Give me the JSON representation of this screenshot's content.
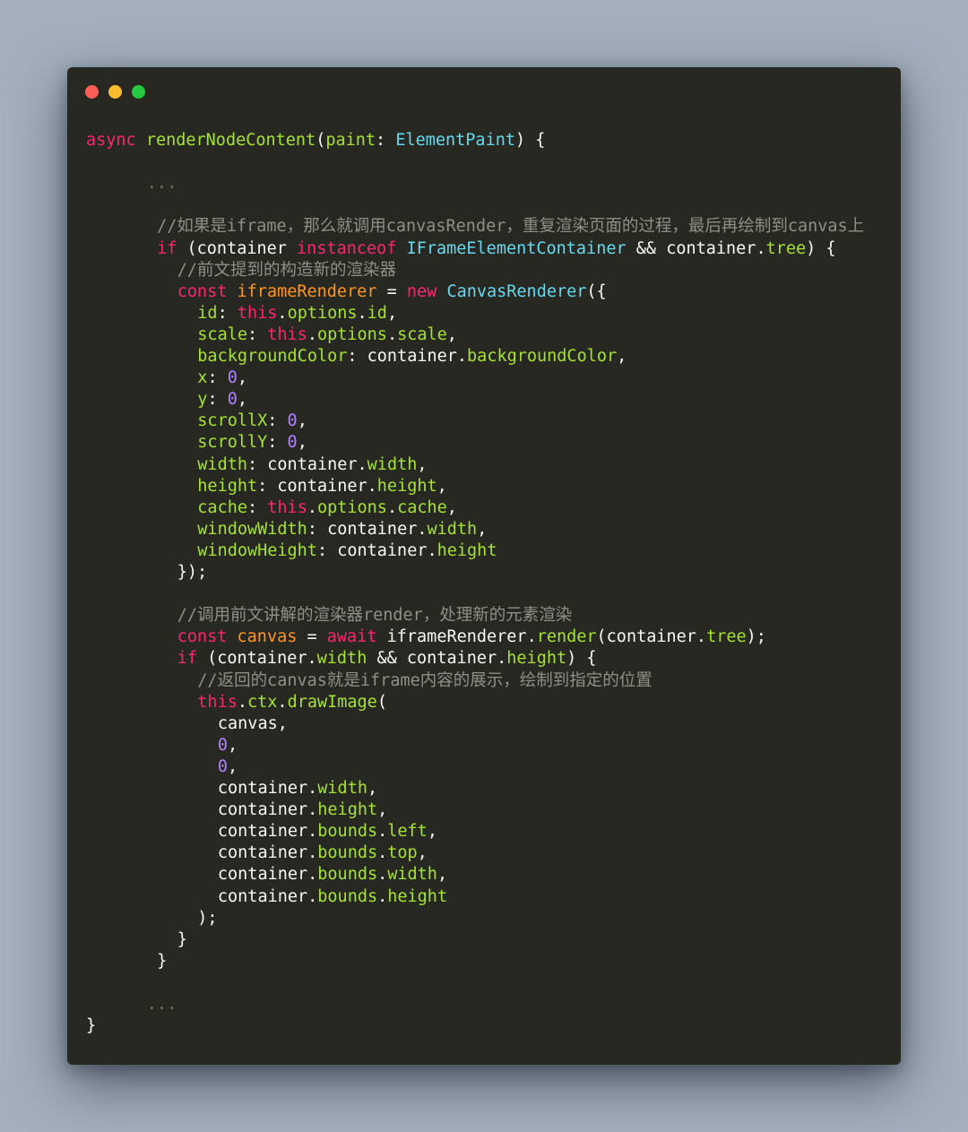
{
  "window": {
    "lights": [
      {
        "name": "close",
        "color": "#ff5f56"
      },
      {
        "name": "minimize",
        "color": "#ffbd2e"
      },
      {
        "name": "maximize",
        "color": "#27c93f"
      }
    ]
  },
  "colors": {
    "background": "#a3afbc",
    "editor": "#272822"
  },
  "code": {
    "lines": [
      {
        "indent": 0,
        "tokens": [
          [
            "kw",
            "async"
          ],
          [
            "pn",
            " "
          ],
          [
            "fn",
            "renderNodeContent"
          ],
          [
            "pn",
            "("
          ],
          [
            "pr",
            "paint"
          ],
          [
            "pn",
            ": "
          ],
          [
            "ty",
            "ElementPaint"
          ],
          [
            "pn",
            ") {"
          ]
        ]
      },
      {
        "indent": 0,
        "tokens": []
      },
      {
        "indent": 3,
        "tokens": [
          [
            "cm",
            "..."
          ]
        ]
      },
      {
        "indent": 0,
        "tokens": []
      },
      {
        "indent": 3.5,
        "tokens": [
          [
            "cmi",
            "//如果是iframe，那么就调用canvasRender，重复渲染页面的过程，最后再绘制到canvas上"
          ]
        ]
      },
      {
        "indent": 3.5,
        "tokens": [
          [
            "kw",
            "if"
          ],
          [
            "pn",
            " ("
          ],
          [
            "pn",
            "container "
          ],
          [
            "kw",
            "instanceof"
          ],
          [
            "pn",
            " "
          ],
          [
            "ty",
            "IFrameElementContainer"
          ],
          [
            "pn",
            " && "
          ],
          [
            "pn",
            "container"
          ],
          [
            "pn",
            "."
          ],
          [
            "fn",
            "tree"
          ],
          [
            "pn",
            ") {"
          ]
        ]
      },
      {
        "indent": 4.5,
        "tokens": [
          [
            "cmi",
            "//前文提到的构造新的渲染器"
          ]
        ]
      },
      {
        "indent": 4.5,
        "tokens": [
          [
            "kw",
            "const"
          ],
          [
            "pn",
            " "
          ],
          [
            "vr",
            "iframeRenderer"
          ],
          [
            "pn",
            " = "
          ],
          [
            "kw",
            "new"
          ],
          [
            "pn",
            " "
          ],
          [
            "ty",
            "CanvasRenderer"
          ],
          [
            "pn",
            "({"
          ]
        ]
      },
      {
        "indent": 5.5,
        "tokens": [
          [
            "fn",
            "id"
          ],
          [
            "pn",
            ": "
          ],
          [
            "kw",
            "this"
          ],
          [
            "pn",
            "."
          ],
          [
            "fn",
            "options"
          ],
          [
            "pn",
            "."
          ],
          [
            "fn",
            "id"
          ],
          [
            "pn",
            ","
          ]
        ]
      },
      {
        "indent": 5.5,
        "tokens": [
          [
            "fn",
            "scale"
          ],
          [
            "pn",
            ": "
          ],
          [
            "kw",
            "this"
          ],
          [
            "pn",
            "."
          ],
          [
            "fn",
            "options"
          ],
          [
            "pn",
            "."
          ],
          [
            "fn",
            "scale"
          ],
          [
            "pn",
            ","
          ]
        ]
      },
      {
        "indent": 5.5,
        "tokens": [
          [
            "fn",
            "backgroundColor"
          ],
          [
            "pn",
            ": "
          ],
          [
            "pn",
            "container"
          ],
          [
            "pn",
            "."
          ],
          [
            "fn",
            "backgroundColor"
          ],
          [
            "pn",
            ","
          ]
        ]
      },
      {
        "indent": 5.5,
        "tokens": [
          [
            "fn",
            "x"
          ],
          [
            "pn",
            ": "
          ],
          [
            "nm",
            "0"
          ],
          [
            "pn",
            ","
          ]
        ]
      },
      {
        "indent": 5.5,
        "tokens": [
          [
            "fn",
            "y"
          ],
          [
            "pn",
            ": "
          ],
          [
            "nm",
            "0"
          ],
          [
            "pn",
            ","
          ]
        ]
      },
      {
        "indent": 5.5,
        "tokens": [
          [
            "fn",
            "scrollX"
          ],
          [
            "pn",
            ": "
          ],
          [
            "nm",
            "0"
          ],
          [
            "pn",
            ","
          ]
        ]
      },
      {
        "indent": 5.5,
        "tokens": [
          [
            "fn",
            "scrollY"
          ],
          [
            "pn",
            ": "
          ],
          [
            "nm",
            "0"
          ],
          [
            "pn",
            ","
          ]
        ]
      },
      {
        "indent": 5.5,
        "tokens": [
          [
            "fn",
            "width"
          ],
          [
            "pn",
            ": "
          ],
          [
            "pn",
            "container"
          ],
          [
            "pn",
            "."
          ],
          [
            "fn",
            "width"
          ],
          [
            "pn",
            ","
          ]
        ]
      },
      {
        "indent": 5.5,
        "tokens": [
          [
            "fn",
            "height"
          ],
          [
            "pn",
            ": "
          ],
          [
            "pn",
            "container"
          ],
          [
            "pn",
            "."
          ],
          [
            "fn",
            "height"
          ],
          [
            "pn",
            ","
          ]
        ]
      },
      {
        "indent": 5.5,
        "tokens": [
          [
            "fn",
            "cache"
          ],
          [
            "pn",
            ": "
          ],
          [
            "kw",
            "this"
          ],
          [
            "pn",
            "."
          ],
          [
            "fn",
            "options"
          ],
          [
            "pn",
            "."
          ],
          [
            "fn",
            "cache"
          ],
          [
            "pn",
            ","
          ]
        ]
      },
      {
        "indent": 5.5,
        "tokens": [
          [
            "fn",
            "windowWidth"
          ],
          [
            "pn",
            ": "
          ],
          [
            "pn",
            "container"
          ],
          [
            "pn",
            "."
          ],
          [
            "fn",
            "width"
          ],
          [
            "pn",
            ","
          ]
        ]
      },
      {
        "indent": 5.5,
        "tokens": [
          [
            "fn",
            "windowHeight"
          ],
          [
            "pn",
            ": "
          ],
          [
            "pn",
            "container"
          ],
          [
            "pn",
            "."
          ],
          [
            "fn",
            "height"
          ]
        ]
      },
      {
        "indent": 4.5,
        "tokens": [
          [
            "pn",
            "});"
          ]
        ]
      },
      {
        "indent": 0,
        "tokens": []
      },
      {
        "indent": 4.5,
        "tokens": [
          [
            "cmi",
            "//调用前文讲解的渲染器render，处理新的元素渲染"
          ]
        ]
      },
      {
        "indent": 4.5,
        "tokens": [
          [
            "kw",
            "const"
          ],
          [
            "pn",
            " "
          ],
          [
            "vr",
            "canvas"
          ],
          [
            "pn",
            " = "
          ],
          [
            "kw",
            "await"
          ],
          [
            "pn",
            " "
          ],
          [
            "pn",
            "iframeRenderer"
          ],
          [
            "pn",
            "."
          ],
          [
            "fn",
            "render"
          ],
          [
            "pn",
            "("
          ],
          [
            "pn",
            "container"
          ],
          [
            "pn",
            "."
          ],
          [
            "fn",
            "tree"
          ],
          [
            "pn",
            ");"
          ]
        ]
      },
      {
        "indent": 4.5,
        "tokens": [
          [
            "kw",
            "if"
          ],
          [
            "pn",
            " ("
          ],
          [
            "pn",
            "container"
          ],
          [
            "pn",
            "."
          ],
          [
            "fn",
            "width"
          ],
          [
            "pn",
            " && "
          ],
          [
            "pn",
            "container"
          ],
          [
            "pn",
            "."
          ],
          [
            "fn",
            "height"
          ],
          [
            "pn",
            ") {"
          ]
        ]
      },
      {
        "indent": 5.5,
        "tokens": [
          [
            "cmi",
            "//返回的canvas就是iframe内容的展示，绘制到指定的位置"
          ]
        ]
      },
      {
        "indent": 5.5,
        "tokens": [
          [
            "kw",
            "this"
          ],
          [
            "pn",
            "."
          ],
          [
            "fn",
            "ctx"
          ],
          [
            "pn",
            "."
          ],
          [
            "fn",
            "drawImage"
          ],
          [
            "pn",
            "("
          ]
        ]
      },
      {
        "indent": 6.5,
        "tokens": [
          [
            "pn",
            "canvas,"
          ]
        ]
      },
      {
        "indent": 6.5,
        "tokens": [
          [
            "nm",
            "0"
          ],
          [
            "pn",
            ","
          ]
        ]
      },
      {
        "indent": 6.5,
        "tokens": [
          [
            "nm",
            "0"
          ],
          [
            "pn",
            ","
          ]
        ]
      },
      {
        "indent": 6.5,
        "tokens": [
          [
            "pn",
            "container"
          ],
          [
            "pn",
            "."
          ],
          [
            "fn",
            "width"
          ],
          [
            "pn",
            ","
          ]
        ]
      },
      {
        "indent": 6.5,
        "tokens": [
          [
            "pn",
            "container"
          ],
          [
            "pn",
            "."
          ],
          [
            "fn",
            "height"
          ],
          [
            "pn",
            ","
          ]
        ]
      },
      {
        "indent": 6.5,
        "tokens": [
          [
            "pn",
            "container"
          ],
          [
            "pn",
            "."
          ],
          [
            "fn",
            "bounds"
          ],
          [
            "pn",
            "."
          ],
          [
            "fn",
            "left"
          ],
          [
            "pn",
            ","
          ]
        ]
      },
      {
        "indent": 6.5,
        "tokens": [
          [
            "pn",
            "container"
          ],
          [
            "pn",
            "."
          ],
          [
            "fn",
            "bounds"
          ],
          [
            "pn",
            "."
          ],
          [
            "fn",
            "top"
          ],
          [
            "pn",
            ","
          ]
        ]
      },
      {
        "indent": 6.5,
        "tokens": [
          [
            "pn",
            "container"
          ],
          [
            "pn",
            "."
          ],
          [
            "fn",
            "bounds"
          ],
          [
            "pn",
            "."
          ],
          [
            "fn",
            "width"
          ],
          [
            "pn",
            ","
          ]
        ]
      },
      {
        "indent": 6.5,
        "tokens": [
          [
            "pn",
            "container"
          ],
          [
            "pn",
            "."
          ],
          [
            "fn",
            "bounds"
          ],
          [
            "pn",
            "."
          ],
          [
            "fn",
            "height"
          ]
        ]
      },
      {
        "indent": 5.5,
        "tokens": [
          [
            "pn",
            ");"
          ]
        ]
      },
      {
        "indent": 4.5,
        "tokens": [
          [
            "pn",
            "}"
          ]
        ]
      },
      {
        "indent": 3.5,
        "tokens": [
          [
            "pn",
            "}"
          ]
        ]
      },
      {
        "indent": 0,
        "tokens": []
      },
      {
        "indent": 3,
        "tokens": [
          [
            "cm",
            "..."
          ]
        ]
      },
      {
        "indent": 0,
        "tokens": [
          [
            "pn",
            "}"
          ]
        ]
      }
    ]
  }
}
